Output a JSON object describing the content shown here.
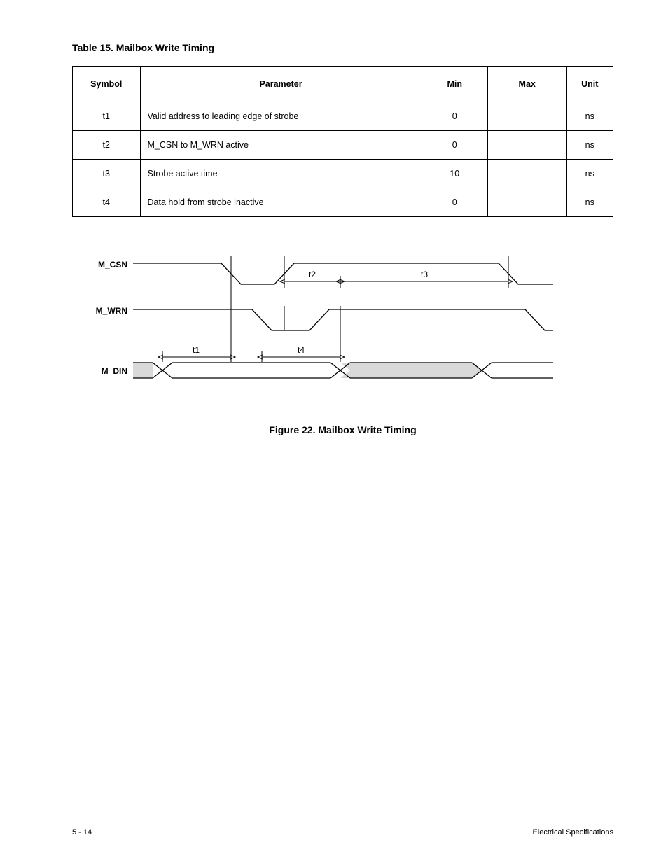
{
  "table": {
    "title_prefix": "Table 15.",
    "title_rest": "Mailbox Write Timing",
    "headers": {
      "symbol": "Symbol",
      "parameter": "Parameter",
      "min": "Min",
      "max": "Max",
      "unit": "Unit"
    },
    "rows": [
      {
        "symbol": "t1",
        "sub": "",
        "parameter": "Valid address to leading edge of strobe",
        "min": "0",
        "max": "",
        "unit": "ns"
      },
      {
        "symbol": "t2",
        "sub": "",
        "parameter": "M_CSN to M_WRN active",
        "min": "0",
        "max": "",
        "unit": "ns"
      },
      {
        "symbol": "t3",
        "sub": "",
        "parameter": "Strobe active time",
        "min": "10",
        "max": "",
        "unit": "ns"
      },
      {
        "symbol": "t4",
        "sub": "",
        "parameter": "Data hold from strobe inactive",
        "min": "0",
        "max": "",
        "unit": "ns"
      }
    ]
  },
  "timing": {
    "signals": {
      "csn": "M_CSN",
      "wrn": "M_WRN",
      "din": "M_DIN"
    },
    "labels": {
      "t1": "t1",
      "t2": "t2",
      "t3": "t3",
      "t4": "t4"
    },
    "caption_prefix": "Figure 22.",
    "caption_rest": "Mailbox Write Timing"
  },
  "footer": {
    "left": "5 - 14",
    "right": "Electrical Specifications"
  }
}
